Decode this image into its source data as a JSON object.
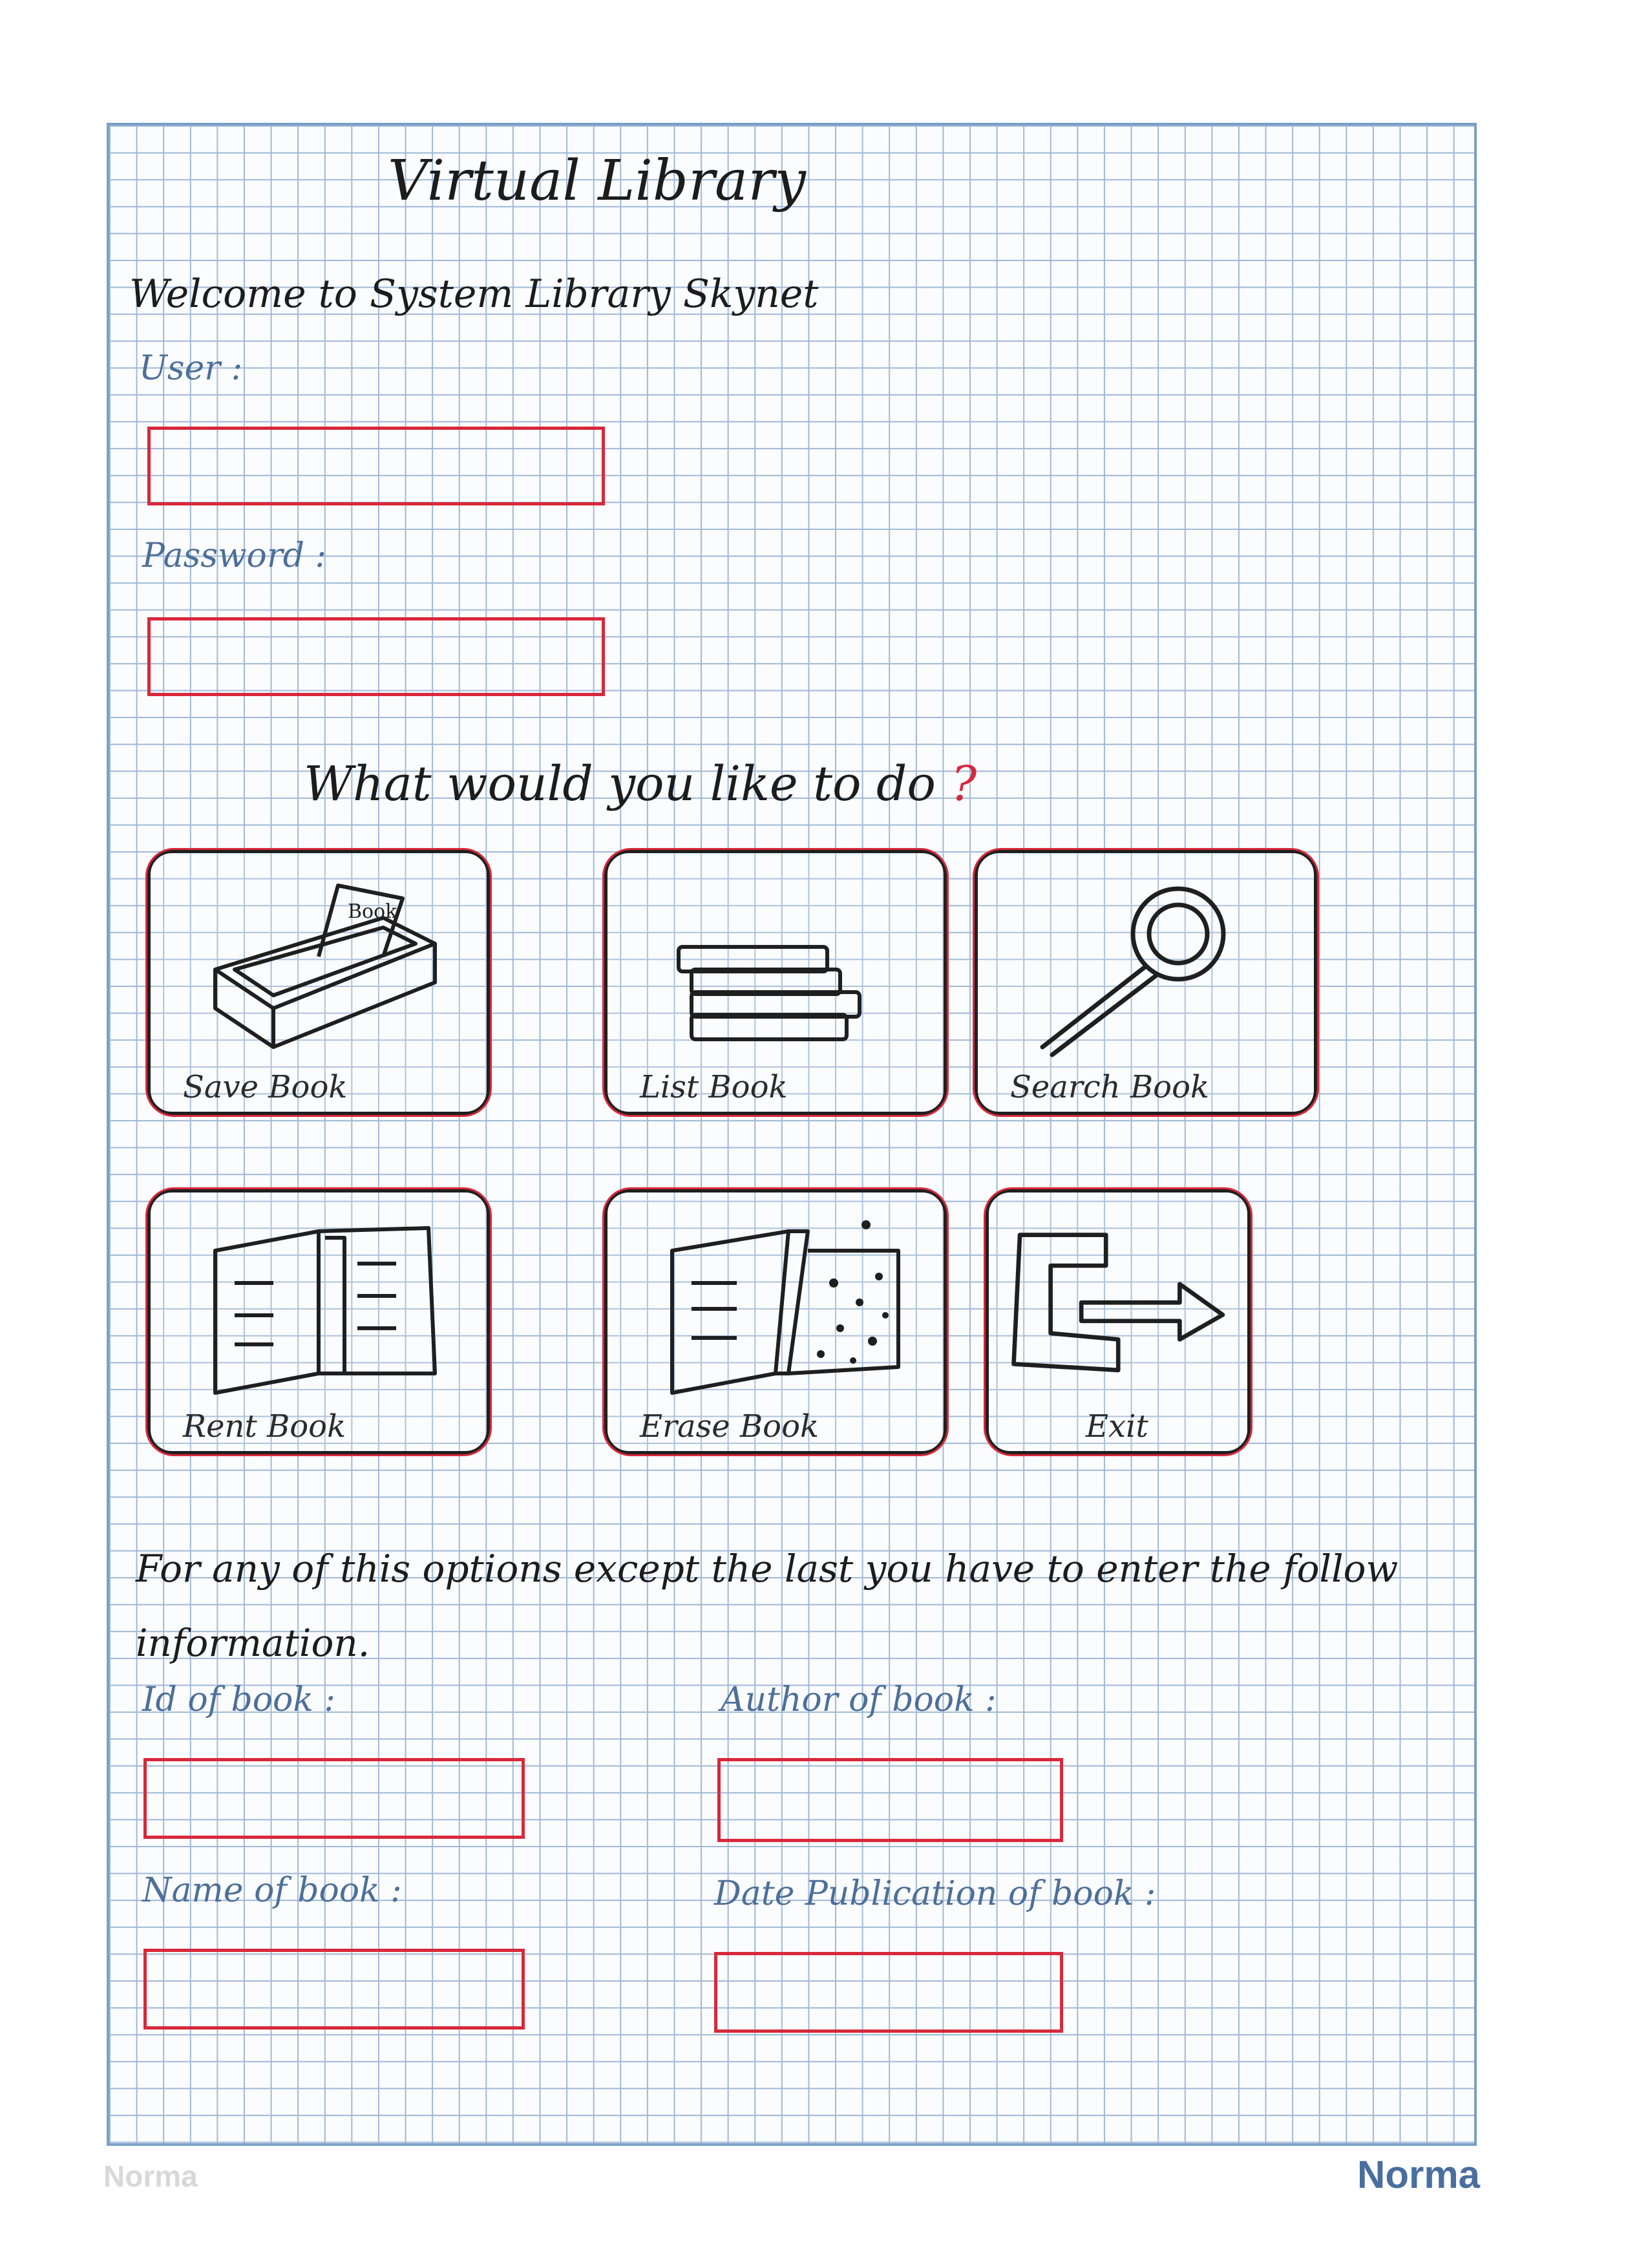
{
  "app": {
    "title": "Virtual Library",
    "welcome": "Welcome to System Library Skynet"
  },
  "login": {
    "user_label": "User :",
    "password_label": "Password :"
  },
  "menu": {
    "prompt": "What would you like to do",
    "prompt_mark": "?",
    "options": [
      {
        "label": "Save Book",
        "icon": "book-box-icon"
      },
      {
        "label": "List Book",
        "icon": "book-stack-icon"
      },
      {
        "label": "Search Book",
        "icon": "magnifier-icon"
      },
      {
        "label": "Rent Book",
        "icon": "open-book-icon"
      },
      {
        "label": "Erase Book",
        "icon": "eraser-book-icon"
      },
      {
        "label": "Exit",
        "icon": "exit-arrow-icon"
      }
    ]
  },
  "instructions": "For any of this options except the last you have to enter the follow information.",
  "book_form": {
    "id_label": "Id of book :",
    "author_label": "Author of book :",
    "name_label": "Name of book :",
    "date_label": "Date Publication of book :"
  },
  "branding": {
    "left": "Norma",
    "right": "Norma"
  },
  "colors": {
    "grid": "#9fb8d6",
    "accent_red": "#d8283a",
    "ink": "#1c1c1c"
  }
}
